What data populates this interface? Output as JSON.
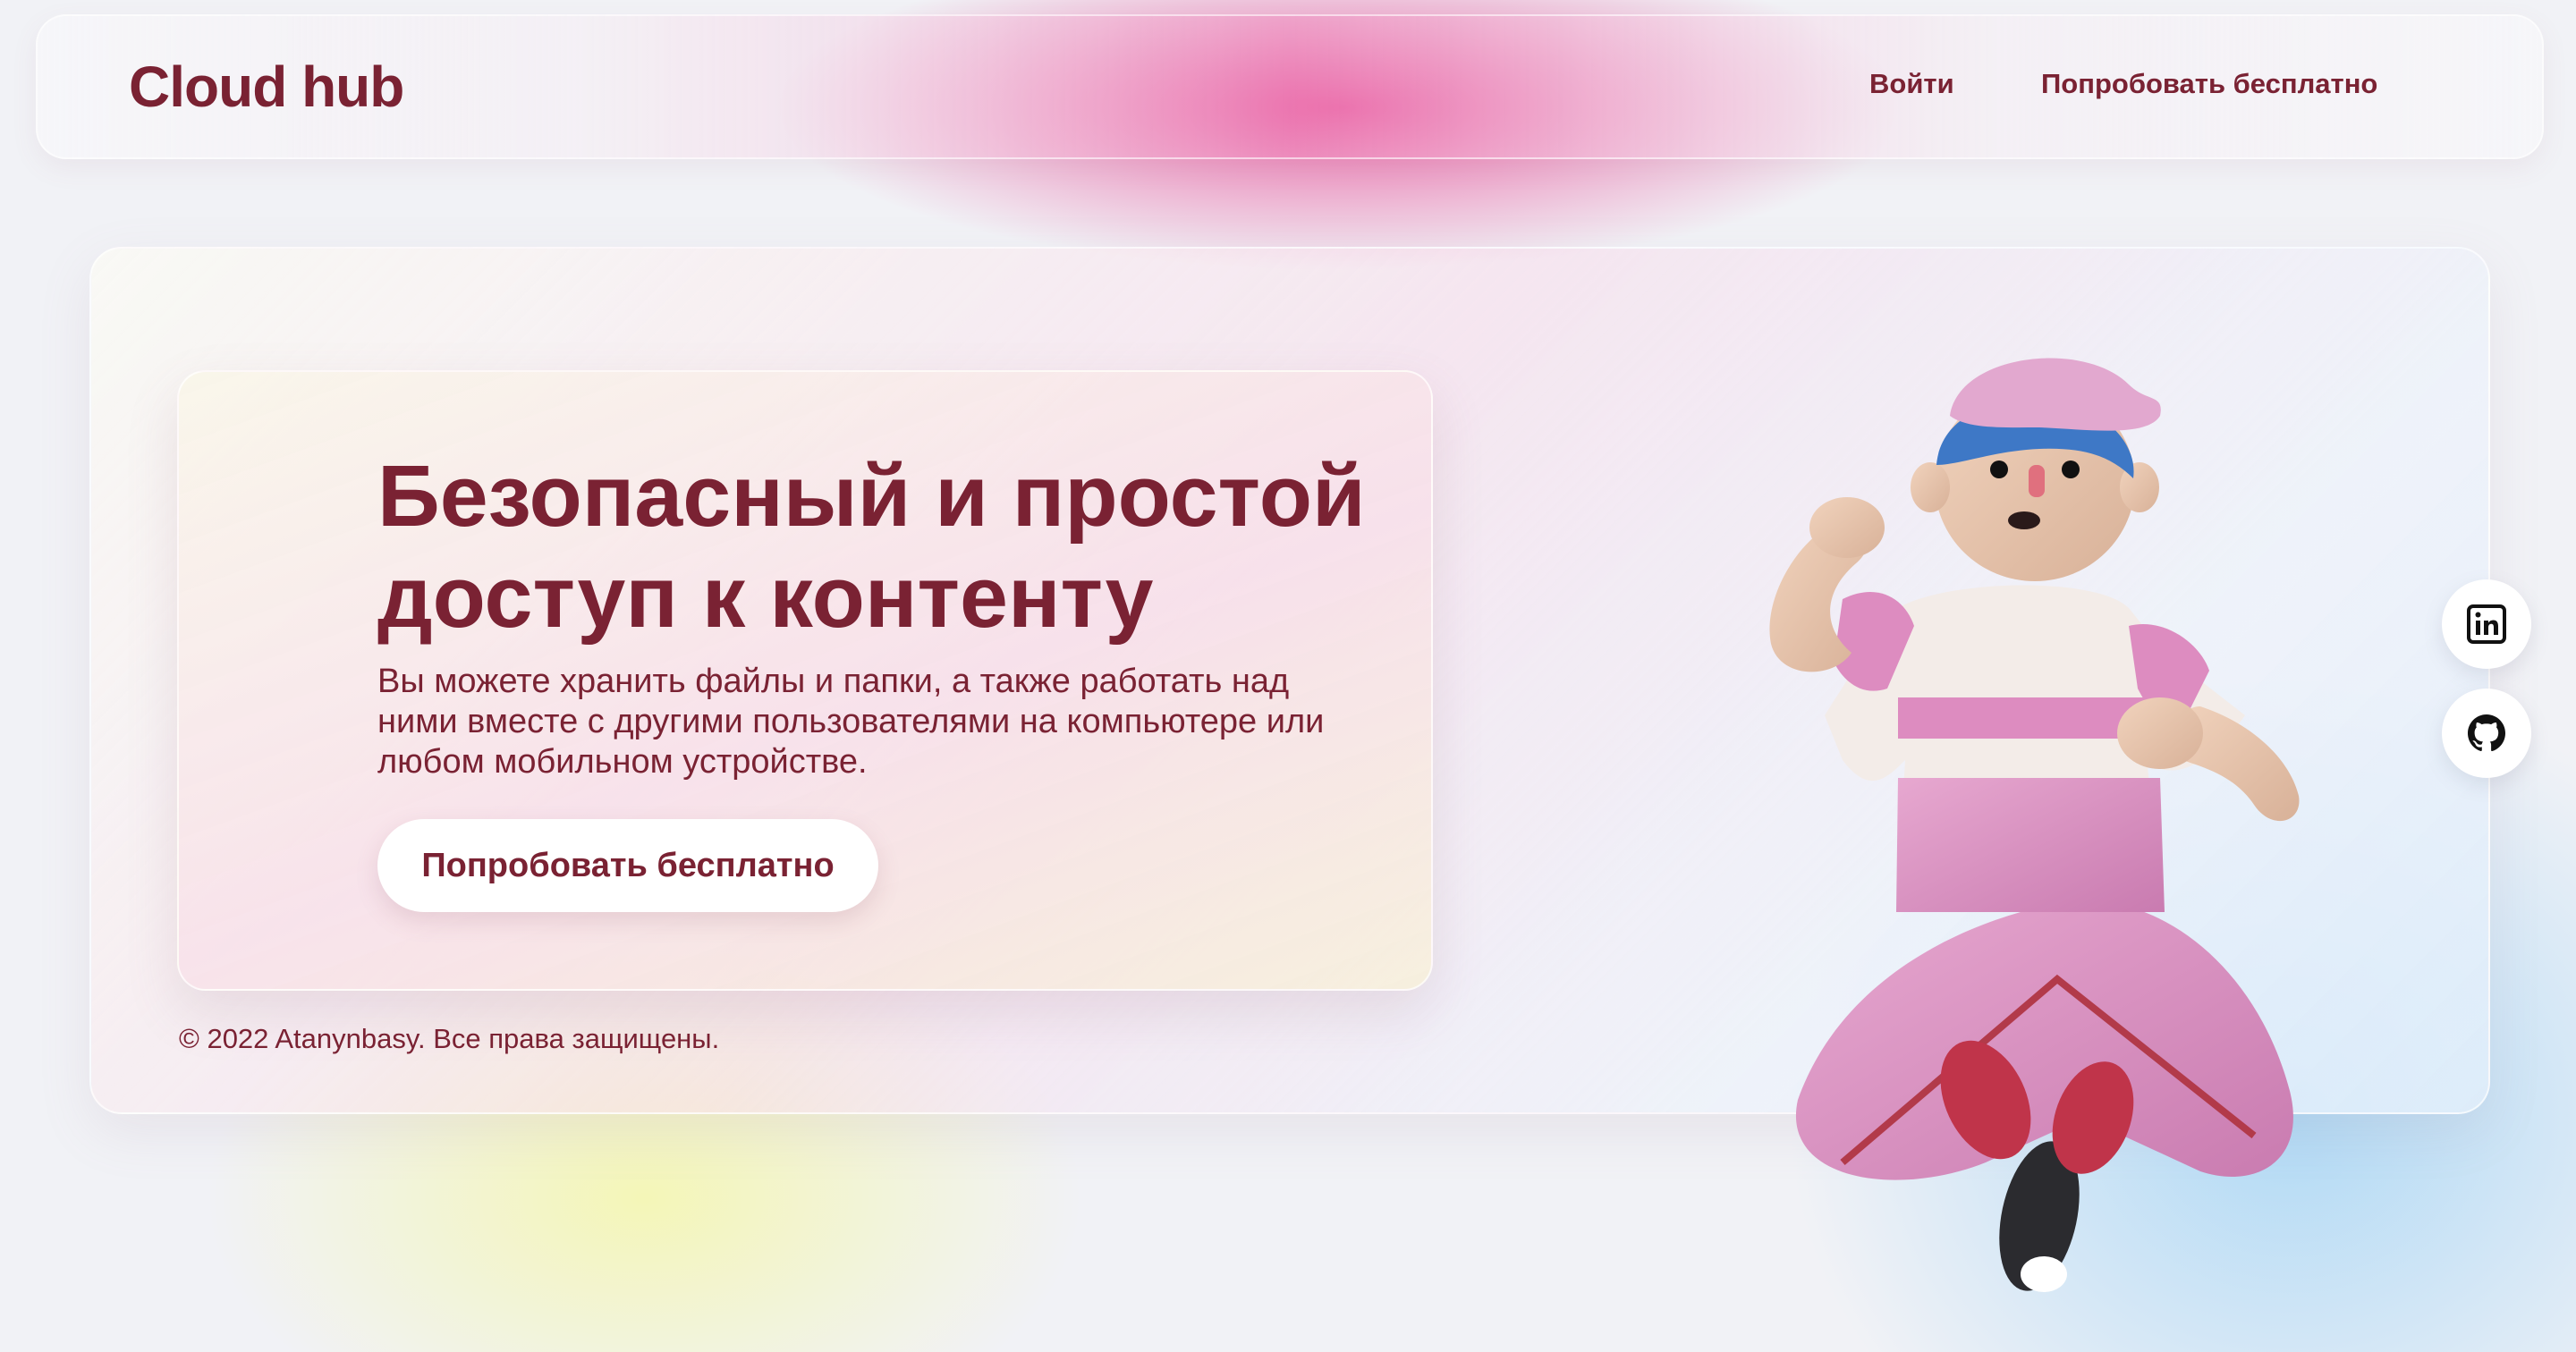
{
  "header": {
    "brand": "Cloud hub",
    "nav": {
      "login": "Войти",
      "try_free": "Попробовать бесплатно"
    }
  },
  "hero": {
    "title": "Безопасный и простой доступ к контенту",
    "description": "Вы можете хранить файлы и папки, а также работать над ними вместе с другими пользователями на компьютере или любом мобильном устройстве.",
    "cta": "Попробовать бесплатно"
  },
  "footer": {
    "copyright": "© 2022 Atanynbasy. Все права защищены."
  },
  "social": [
    {
      "icon": "linkedin-icon"
    },
    {
      "icon": "github-icon"
    }
  ],
  "colors": {
    "text": "#7a2233",
    "accent_pink": "#e85ca0",
    "button_bg": "#ffffff"
  }
}
